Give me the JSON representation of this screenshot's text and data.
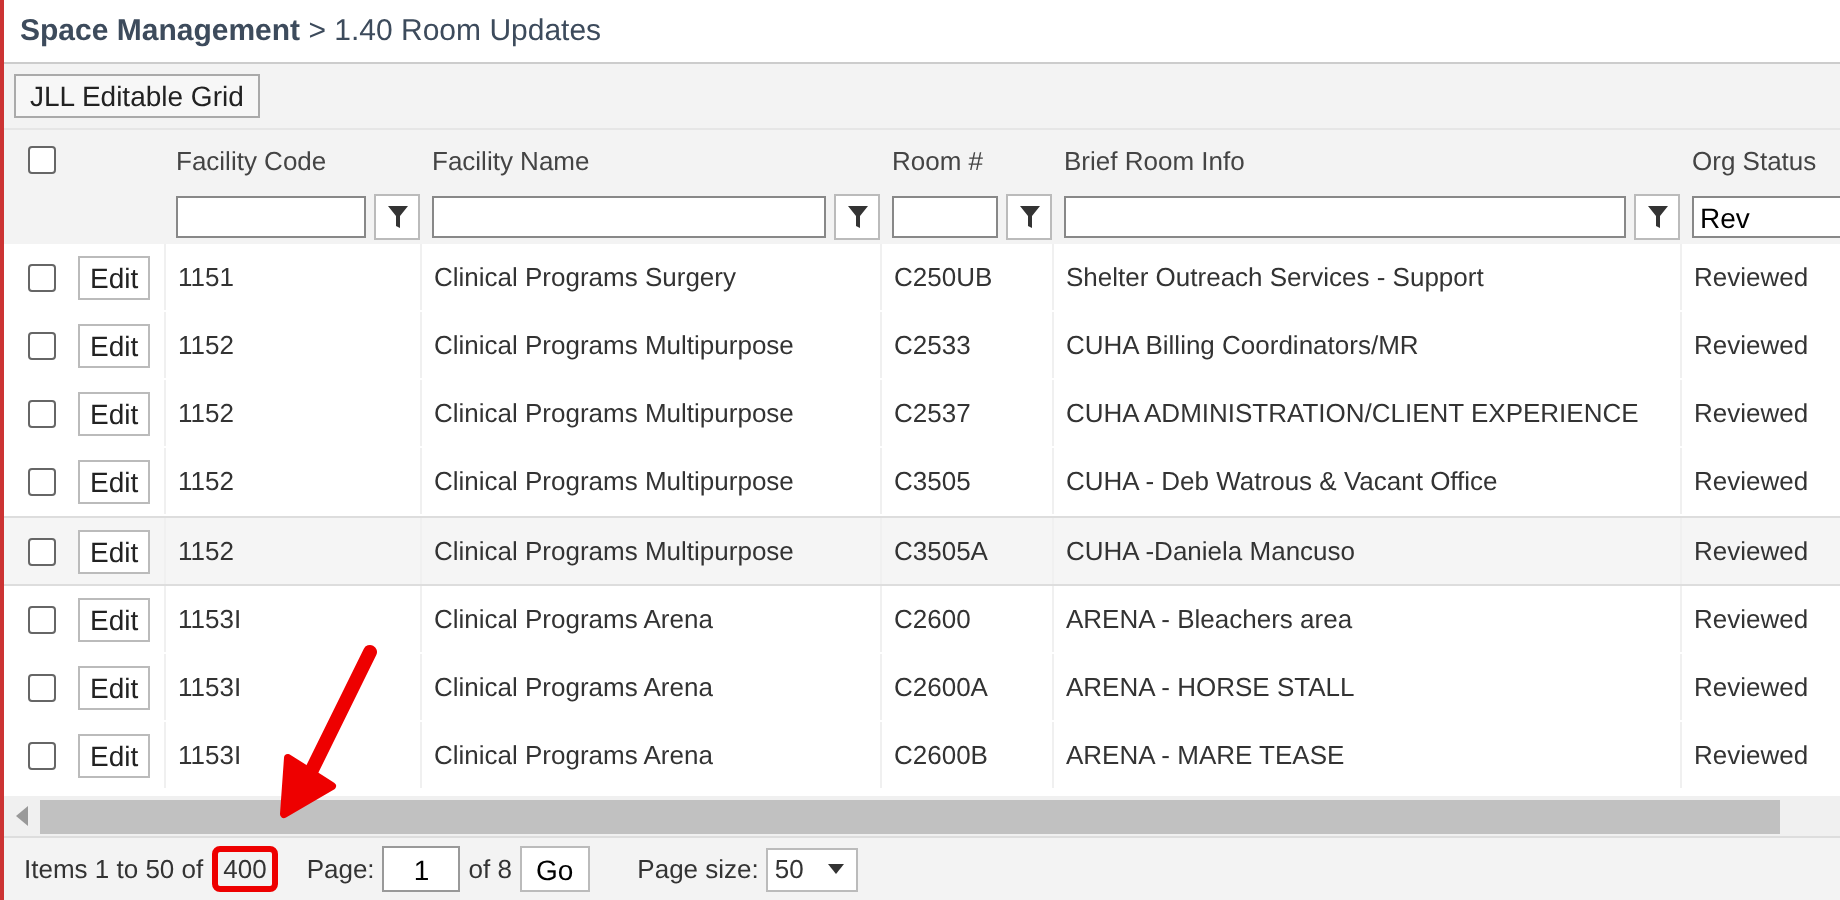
{
  "breadcrumb": {
    "section": "Space Management",
    "page": "> 1.40 Room Updates"
  },
  "toolbar": {
    "button": "JLL Editable Grid"
  },
  "table": {
    "select_all_checked": false,
    "columns": [
      {
        "label": "Facility Code"
      },
      {
        "label": "Facility Name"
      },
      {
        "label": "Room #"
      },
      {
        "label": "Brief Room Info"
      },
      {
        "label": "Org Status",
        "filter": "Rev"
      }
    ],
    "rows": [
      {
        "checked": false,
        "highlighted": false,
        "action": "Edit",
        "cells": [
          "1151",
          "Clinical Programs Surgery",
          "C250UB",
          "Shelter Outreach Services - Support",
          "Reviewed"
        ]
      },
      {
        "checked": false,
        "highlighted": false,
        "action": "Edit",
        "cells": [
          "1152",
          "Clinical Programs Multipurpose",
          "C2533",
          "CUHA Billing Coordinators/MR",
          "Reviewed"
        ]
      },
      {
        "checked": false,
        "highlighted": false,
        "action": "Edit",
        "cells": [
          "1152",
          "Clinical Programs Multipurpose",
          "C2537",
          "CUHA ADMINISTRATION/CLIENT EXPERIENCE",
          "Reviewed"
        ]
      },
      {
        "checked": false,
        "highlighted": false,
        "action": "Edit",
        "cells": [
          "1152",
          "Clinical Programs Multipurpose",
          "C3505",
          "CUHA - Deb Watrous & Vacant Office",
          "Reviewed"
        ]
      },
      {
        "checked": false,
        "highlighted": true,
        "action": "Edit",
        "cells": [
          "1152",
          "Clinical Programs Multipurpose",
          "C3505A",
          "CUHA -Daniela Mancuso",
          "Reviewed"
        ]
      },
      {
        "checked": false,
        "highlighted": false,
        "action": "Edit",
        "cells": [
          "1153I",
          "Clinical Programs Arena",
          "C2600",
          "ARENA - Bleachers area",
          "Reviewed"
        ]
      },
      {
        "checked": false,
        "highlighted": false,
        "action": "Edit",
        "cells": [
          "1153I",
          "Clinical Programs Arena",
          "C2600A",
          "ARENA - HORSE STALL",
          "Reviewed"
        ]
      },
      {
        "checked": false,
        "highlighted": false,
        "action": "Edit",
        "cells": [
          "1153I",
          "Clinical Programs Arena",
          "C2600B",
          "ARENA - MARE TEASE",
          "Reviewed"
        ]
      }
    ]
  },
  "pager": {
    "items_text": "Items 1 to 50 of",
    "total": "400",
    "total_highlighted": true,
    "page_label": "Page:",
    "page": "1",
    "of_text": "of 8",
    "go": "Go",
    "size_label": "Page size:",
    "size": "50"
  }
}
